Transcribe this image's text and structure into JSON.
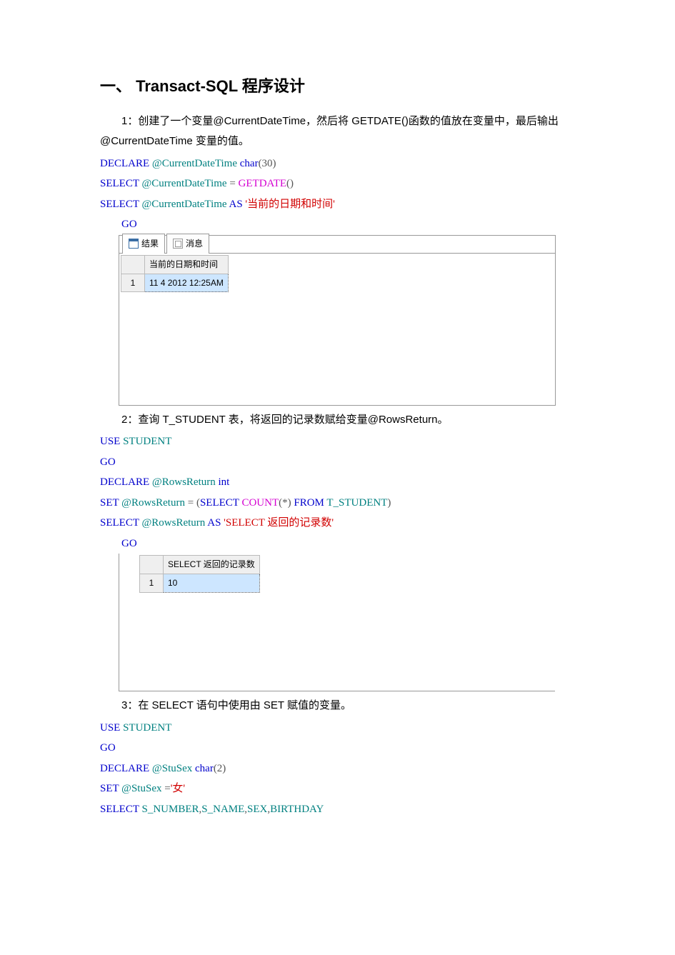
{
  "heading": "一、 Transact-SQL 程序设计",
  "section1": {
    "desc": "1：创建了一个变量@CurrentDateTime，然后将 GETDATE()函数的值放在变量中，最后输出@CurrentDateTime 变量的值。",
    "line1_a": "DECLARE",
    "line1_b": " @CurrentDateTime    ",
    "line1_c": "char",
    "line1_d": "(30)",
    "line2_a": "SELECT",
    "line2_b": "    @CurrentDateTime ",
    "line2_c": "=",
    "line2_d": " GETDATE",
    "line2_e": "()",
    "line3_a": "SELECT",
    "line3_b": " @CurrentDateTime ",
    "line3_c": "AS",
    "line3_d": " '当前的日期和时间'",
    "go": "GO",
    "tab_results": "结果",
    "tab_messages": "消息",
    "col_header": "当前的日期和时间",
    "row_num": "1",
    "cell_value": "11  4 2012 12:25AM"
  },
  "section2": {
    "desc": "2：查询 T_STUDENT 表，将返回的记录数赋给变量@RowsReturn。",
    "l1_a": "USE",
    "l1_b": " STUDENT",
    "go1": "GO",
    "l2_a": "DECLARE",
    "l2_b": " @RowsReturn ",
    "l2_c": "int",
    "l3_a": "SET",
    "l3_b": " @RowsReturn ",
    "l3_c": "=",
    "l3_d": " (",
    "l3_e": "SELECT",
    "l3_f": " COUNT",
    "l3_g": "(*)",
    "l3_h": "    FROM",
    "l3_i": "    T_STUDENT",
    "l3_j": ")",
    "l4_a": "SELECT",
    "l4_b": " @RowsReturn ",
    "l4_c": "AS",
    "l4_d": " 'SELECT    返回的记录数'",
    "go2": "GO",
    "col_header": "SELECT 返回的记录数",
    "row_num": "1",
    "cell_value": "10"
  },
  "section3": {
    "desc": "3：在 SELECT 语句中使用由 SET 赋值的变量。",
    "l1_a": "USE",
    "l1_b": " STUDENT",
    "go1": "GO",
    "l2_a": "DECLARE",
    "l2_b": " @StuSex ",
    "l2_c": "char",
    "l2_d": "(2)",
    "l3_a": "SET",
    "l3_b": " @StuSex ",
    "l3_c": "=",
    "l3_d": "'女'",
    "l4_a": "SELECT",
    "l4_b": " S_NUMBER",
    "l4_c": ",",
    "l4_d": "S_NAME",
    "l4_e": ",",
    "l4_f": "SEX",
    "l4_g": ",",
    "l4_h": "BIRTHDAY"
  }
}
